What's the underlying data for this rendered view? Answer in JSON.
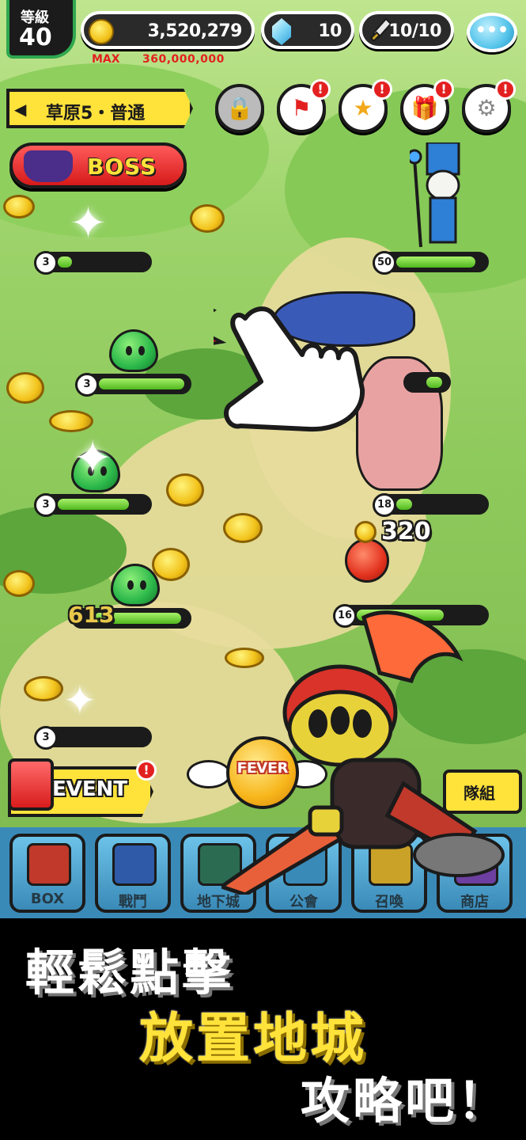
{
  "header": {
    "level_label": "等級",
    "level_value": "40",
    "gold": "3,520,279",
    "gems": "10",
    "stamina": "10/10",
    "max_label": "MAX",
    "max_value": "360,000,000"
  },
  "stage": {
    "name": "草原5・普通"
  },
  "toolbar": {
    "icons": [
      "lock-icon",
      "flag-icon",
      "medal-icon",
      "gift-icon",
      "gear-icon"
    ]
  },
  "boss_button": {
    "label": "BOSS"
  },
  "enemies": {
    "left_levels": [
      "3",
      "3",
      "3",
      "3"
    ],
    "right_levels": [
      "50",
      "18",
      "16"
    ],
    "fills": [
      0.15,
      0.9,
      0.75,
      0.82,
      0.9,
      0.6
    ]
  },
  "damage_numbers": [
    "613",
    "320"
  ],
  "event_button": {
    "label": "EVENT"
  },
  "fever_button": {
    "label": "FEVER"
  },
  "team_button": {
    "label": "隊組"
  },
  "nav": {
    "items": [
      {
        "label": "BOX",
        "color": "#c0392b"
      },
      {
        "label": "戰鬥",
        "color": "#2e5aa8"
      },
      {
        "label": "地下城",
        "color": "#2b6b52"
      },
      {
        "label": "公會",
        "color": "#3a8ab8"
      },
      {
        "label": "召喚",
        "color": "#c9a227"
      },
      {
        "label": "商店",
        "color": "#6c3fa0"
      }
    ]
  },
  "promo": {
    "line1": "輕鬆點擊",
    "line2": "放置地城",
    "line3": "攻略吧！"
  }
}
